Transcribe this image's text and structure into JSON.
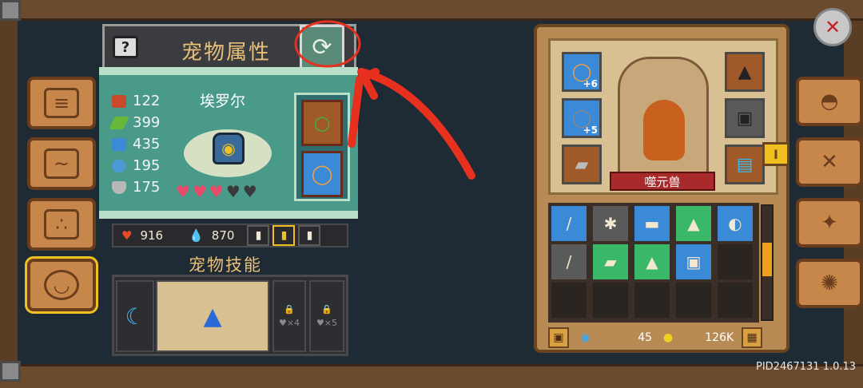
{
  "pet_panel": {
    "title": "宠物属性",
    "help_label": "?",
    "pet_name": "埃罗尔",
    "stats": [
      {
        "icon": "armor-icon",
        "value": "122",
        "color": "#c84a2a"
      },
      {
        "icon": "feather-icon",
        "value": "399",
        "color": "#6ab83a"
      },
      {
        "icon": "book-icon",
        "value": "435",
        "color": "#3a8ad8"
      },
      {
        "icon": "wand-icon",
        "value": "195",
        "color": "#4a9ad8"
      },
      {
        "icon": "shield-icon",
        "value": "175",
        "color": "#b8b8b8"
      }
    ],
    "hearts": {
      "filled": 3,
      "total": 5
    }
  },
  "resources": {
    "hp": "916",
    "mana": "870"
  },
  "skills": {
    "title": "宠物技能",
    "lock_labels": [
      "♥×4",
      "♥×5"
    ]
  },
  "character": {
    "name": "噬元兽",
    "gear_left": [
      {
        "plus": "+6"
      },
      {
        "plus": "+5"
      },
      {
        "plus": ""
      }
    ],
    "gems": "45",
    "gold": "126K"
  },
  "footer": {
    "pid": "PID2467131 1.0.13"
  },
  "colors": {
    "accent": "#e8c078",
    "annotation": "#e8301e"
  }
}
